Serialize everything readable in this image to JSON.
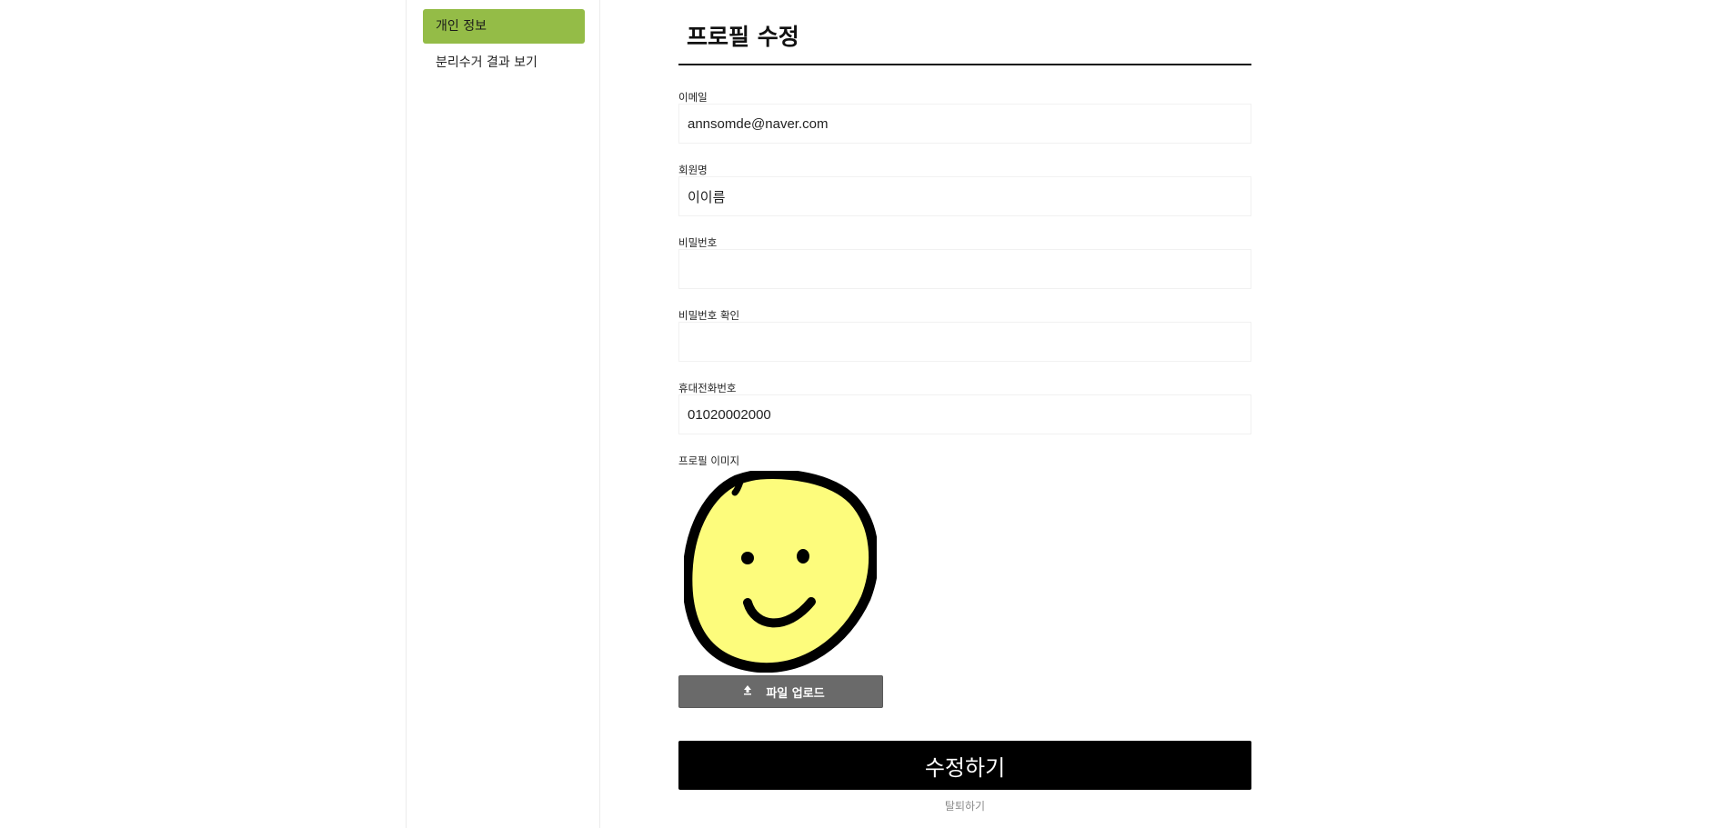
{
  "sidebar": {
    "items": [
      {
        "label": "개인 정보",
        "active": true
      },
      {
        "label": "분리수거 결과 보기",
        "active": false
      }
    ],
    "accent_color": "#94bc47"
  },
  "main": {
    "title": "프로필 수정",
    "fields": {
      "email": {
        "label": "이메일",
        "value": "annsomde@naver.com"
      },
      "name": {
        "label": "회원명",
        "value": "이이름"
      },
      "password": {
        "label": "비밀번호",
        "value": ""
      },
      "password_confirm": {
        "label": "비밀번호 확인",
        "value": ""
      },
      "phone": {
        "label": "휴대전화번호",
        "value": "01020002000"
      }
    },
    "profile_image": {
      "label": "프로필 이미지",
      "icon": "smiley-face-icon"
    },
    "upload_button": {
      "label": "파일 업로드",
      "icon": "upload-arrow-icon"
    },
    "submit_button": {
      "label": "수정하기"
    },
    "withdraw_link": {
      "label": "탈퇴하기"
    }
  }
}
